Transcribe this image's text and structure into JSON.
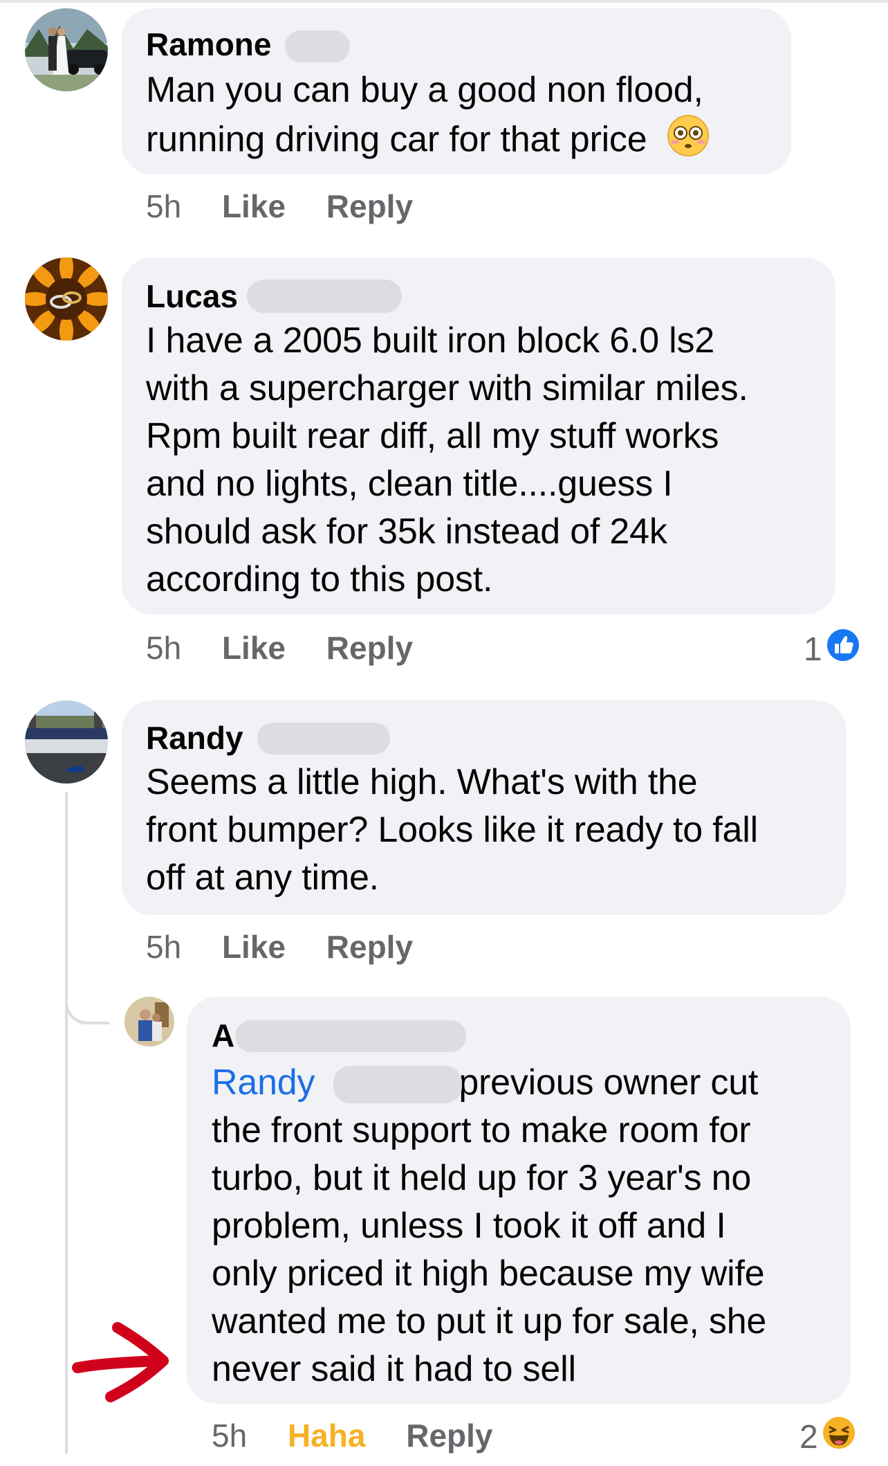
{
  "comments": [
    {
      "name": "Ramone",
      "lines": [
        "Man you can buy a good non flood,",
        "running driving car for that price"
      ],
      "emoji": "flushed-face",
      "time": "5h",
      "like": "Like",
      "reply": "Reply"
    },
    {
      "name": "Lucas",
      "lines": [
        "I have a 2005 built iron block 6.0 ls2",
        "with a supercharger with similar miles.",
        "Rpm built rear diff, all my stuff works",
        "and no lights, clean title....guess I",
        "should ask for 35k instead of 24k",
        "according to this post."
      ],
      "time": "5h",
      "like": "Like",
      "reply": "Reply",
      "reaction_count": "1",
      "reaction_icon": "like-icon"
    },
    {
      "name": "Randy",
      "lines": [
        "Seems a little high. What's with the",
        "front bumper? Looks like it ready to fall",
        "off at any time."
      ],
      "time": "5h",
      "like": "Like",
      "reply": "Reply"
    }
  ],
  "reply_comment": {
    "name": "A",
    "mention": "Randy",
    "first_line_rest": "previous owner cut",
    "lines": [
      "the front support to make room for",
      "turbo, but it held up for 3 year's no",
      "problem, unless I took it off and I",
      "only priced it high because my wife",
      "wanted me to put it up for sale, she",
      "never said it had to sell"
    ],
    "time": "5h",
    "reaction_label": "Haha",
    "reply": "Reply",
    "reaction_count": "2",
    "reaction_icon": "haha-icon"
  },
  "colors": {
    "bubble": "#f0f2f5",
    "meta": "#65676b",
    "mention": "#1d6ee6",
    "haha": "#f7b125",
    "like_blue": "#1877f2",
    "annotation_arrow": "#d0021b"
  }
}
